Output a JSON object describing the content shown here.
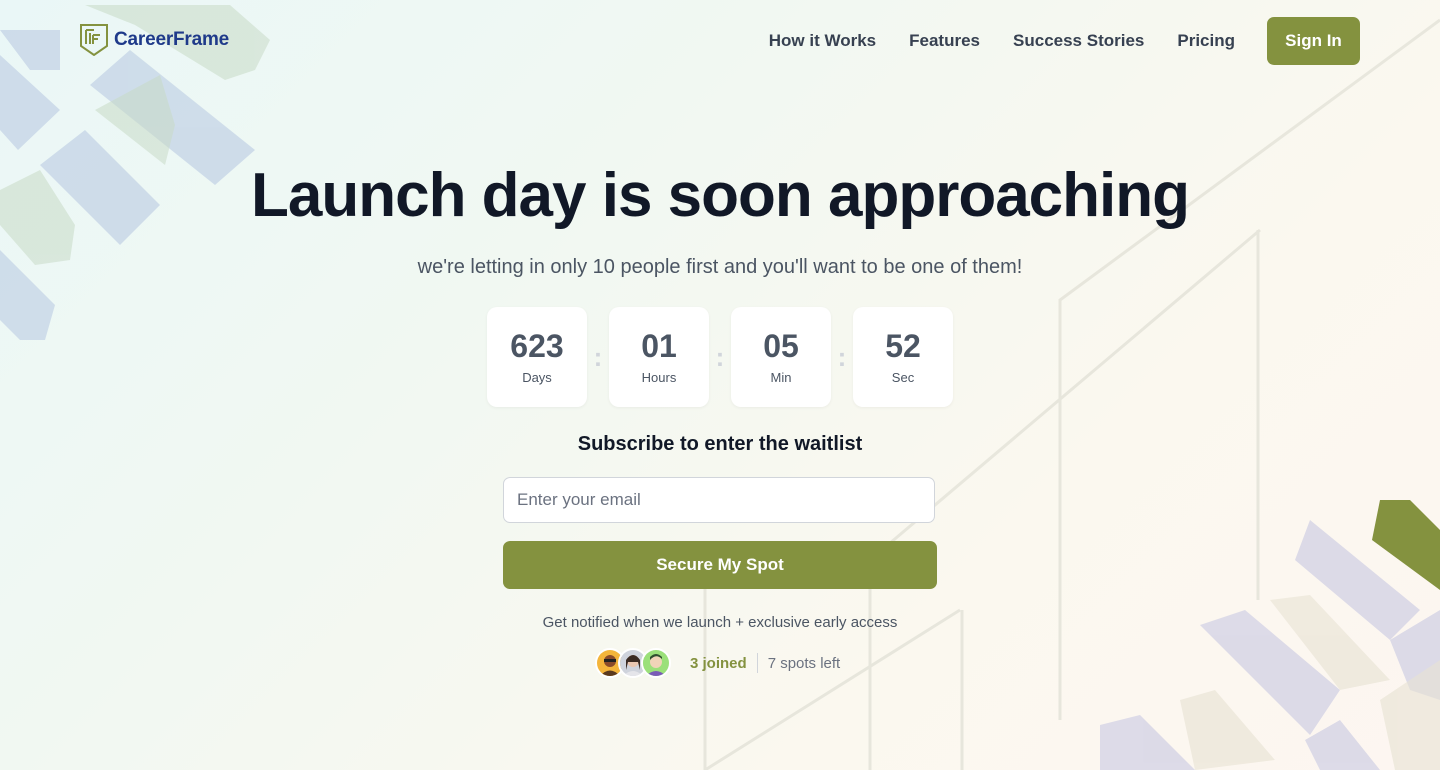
{
  "brand": {
    "name": "CareerFrame",
    "logo_icon": "shield-cf-icon",
    "color": "#1f3a8a"
  },
  "nav": {
    "links": [
      "How it Works",
      "Features",
      "Success Stories",
      "Pricing"
    ],
    "signin_label": "Sign In"
  },
  "hero": {
    "title": "Launch day is soon approaching",
    "subtitle": "we're letting in only 10 people first and you'll want to be one of them!"
  },
  "countdown": {
    "days": {
      "value": "623",
      "label": "Days"
    },
    "hours": {
      "value": "01",
      "label": "Hours"
    },
    "minutes": {
      "value": "05",
      "label": "Min"
    },
    "seconds": {
      "value": "52",
      "label": "Sec"
    },
    "separator": ":"
  },
  "waitlist": {
    "title": "Subscribe to enter the waitlist",
    "email_placeholder": "Enter your email",
    "email_value": "",
    "button_label": "Secure My Spot",
    "note": "Get notified when we launch + exclusive early access",
    "joined": "3 joined",
    "spots_left": "7 spots left"
  },
  "colors": {
    "accent": "#84923f",
    "heading": "#111827",
    "body": "#4b5563"
  }
}
